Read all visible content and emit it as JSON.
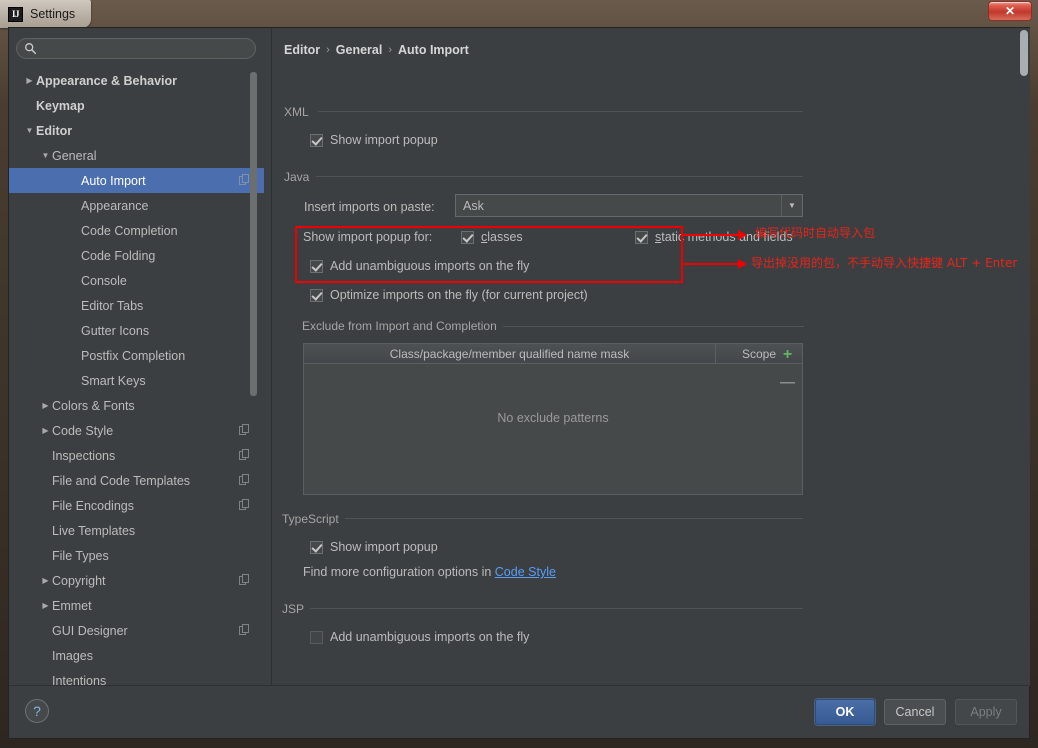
{
  "window": {
    "title": "Settings",
    "logo_text": "IJ",
    "close_label": "✕"
  },
  "sidebar": {
    "search": {
      "value": "",
      "placeholder": ""
    },
    "items": [
      {
        "label": "Appearance & Behavior",
        "level": 0,
        "arrow": "▶",
        "selected": false,
        "copy": false
      },
      {
        "label": "Keymap",
        "level": 0,
        "arrow": "",
        "selected": false,
        "copy": false
      },
      {
        "label": "Editor",
        "level": 0,
        "arrow": "▼",
        "selected": false,
        "copy": false
      },
      {
        "label": "General",
        "level": 1,
        "arrow": "▼",
        "selected": false,
        "copy": false
      },
      {
        "label": "Auto Import",
        "level": 2,
        "arrow": "",
        "selected": true,
        "copy": true
      },
      {
        "label": "Appearance",
        "level": 2,
        "arrow": "",
        "selected": false,
        "copy": false
      },
      {
        "label": "Code Completion",
        "level": 2,
        "arrow": "",
        "selected": false,
        "copy": false
      },
      {
        "label": "Code Folding",
        "level": 2,
        "arrow": "",
        "selected": false,
        "copy": false
      },
      {
        "label": "Console",
        "level": 2,
        "arrow": "",
        "selected": false,
        "copy": false
      },
      {
        "label": "Editor Tabs",
        "level": 2,
        "arrow": "",
        "selected": false,
        "copy": false
      },
      {
        "label": "Gutter Icons",
        "level": 2,
        "arrow": "",
        "selected": false,
        "copy": false
      },
      {
        "label": "Postfix Completion",
        "level": 2,
        "arrow": "",
        "selected": false,
        "copy": false
      },
      {
        "label": "Smart Keys",
        "level": 2,
        "arrow": "",
        "selected": false,
        "copy": false
      },
      {
        "label": "Colors & Fonts",
        "level": 1,
        "arrow": "▶",
        "selected": false,
        "copy": false
      },
      {
        "label": "Code Style",
        "level": 1,
        "arrow": "▶",
        "selected": false,
        "copy": true
      },
      {
        "label": "Inspections",
        "level": 1,
        "arrow": "",
        "selected": false,
        "copy": true
      },
      {
        "label": "File and Code Templates",
        "level": 1,
        "arrow": "",
        "selected": false,
        "copy": true
      },
      {
        "label": "File Encodings",
        "level": 1,
        "arrow": "",
        "selected": false,
        "copy": true
      },
      {
        "label": "Live Templates",
        "level": 1,
        "arrow": "",
        "selected": false,
        "copy": false
      },
      {
        "label": "File Types",
        "level": 1,
        "arrow": "",
        "selected": false,
        "copy": false
      },
      {
        "label": "Copyright",
        "level": 1,
        "arrow": "▶",
        "selected": false,
        "copy": true
      },
      {
        "label": "Emmet",
        "level": 1,
        "arrow": "▶",
        "selected": false,
        "copy": false
      },
      {
        "label": "GUI Designer",
        "level": 1,
        "arrow": "",
        "selected": false,
        "copy": true
      },
      {
        "label": "Images",
        "level": 1,
        "arrow": "",
        "selected": false,
        "copy": false
      },
      {
        "label": "Intentions",
        "level": 1,
        "arrow": "",
        "selected": false,
        "copy": false
      }
    ]
  },
  "main": {
    "breadcrumb": {
      "part1": "Editor",
      "sep1": "›",
      "part2": "General",
      "sep2": "›",
      "part3": "Auto Import"
    },
    "xml": {
      "group_title": "XML",
      "show_import_popup": "Show import popup",
      "show_import_popup_checked": true
    },
    "java": {
      "group_title": "Java",
      "insert_imports_label": "Insert imports on paste:",
      "insert_imports_value": "Ask",
      "show_popup_for_label": "Show import popup for:",
      "classes_label": "classes",
      "classes_checked": true,
      "static_label": "static methods and fields",
      "static_checked": true,
      "add_unambiguous_label": "Add unambiguous imports on the fly",
      "add_unambiguous_checked": true,
      "optimize_label": "Optimize imports on the fly (for current project)",
      "optimize_checked": true
    },
    "exclude": {
      "group_title": "Exclude from Import and Completion",
      "col_name": "Class/package/member qualified name mask",
      "col_scope": "Scope",
      "empty_text": "No exclude patterns",
      "add_label": "+",
      "remove_label": "—"
    },
    "typescript": {
      "group_title": "TypeScript",
      "show_import_popup": "Show import popup",
      "show_import_popup_checked": true,
      "hint_prefix": "Find more configuration options in ",
      "hint_link": "Code Style"
    },
    "jsp": {
      "group_title": "JSP",
      "add_unambiguous_label": "Add unambiguous imports on the fly",
      "add_unambiguous_checked": false
    }
  },
  "annotations": {
    "color": "#ee0000",
    "note1": "编写代码时自动导入包",
    "note2": "导出掉没用的包，不手动导入快捷键 ALT + Enter"
  },
  "footer": {
    "help_label": "?",
    "ok_label": "OK",
    "cancel_label": "Cancel",
    "apply_label": "Apply"
  }
}
